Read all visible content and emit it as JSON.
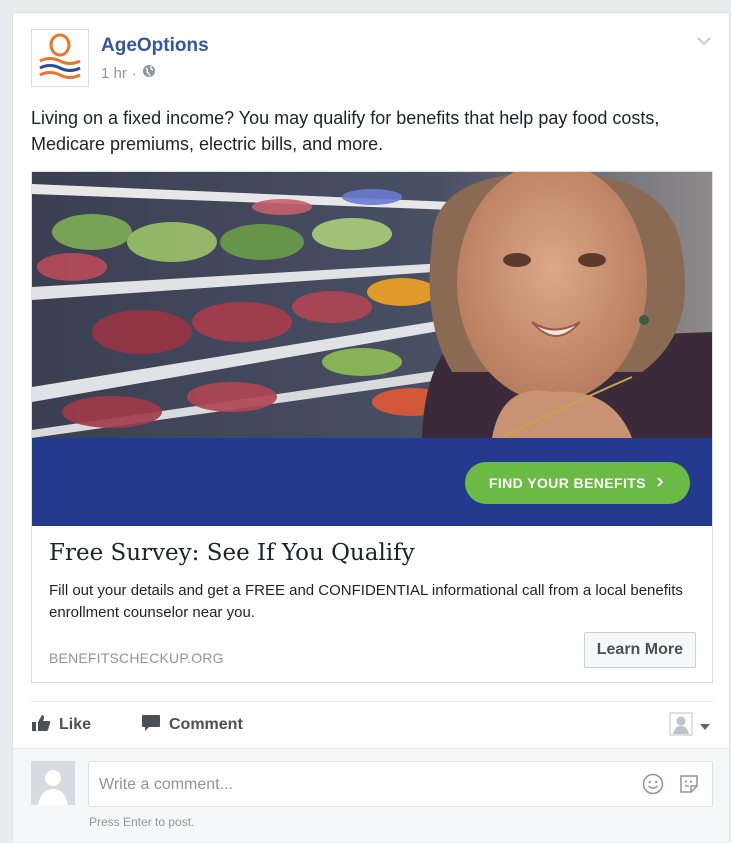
{
  "post": {
    "page_name": "AgeOptions",
    "time": "1 hr",
    "separator": "·",
    "text": "Living on a fixed income? You may qualify for benefits that help pay food costs, Medicare premiums, electric bills, and more."
  },
  "ad": {
    "cta_banner_label": "FIND YOUR BENEFITS",
    "title": "Free Survey: See If You Qualify",
    "description": "Fill out your details and get a FREE and CONFIDENTIAL informational call from a local benefits enrollment counselor near you.",
    "domain": "BENEFITSCHECKUP.ORG",
    "learn_more_label": "Learn More"
  },
  "actions": {
    "like_label": "Like",
    "comment_label": "Comment"
  },
  "comment_box": {
    "placeholder": "Write a comment...",
    "hint": "Press Enter to post."
  },
  "colors": {
    "link_blue": "#365899",
    "band_blue": "#233a8f",
    "cta_green": "#6bba45",
    "logo_orange": "#e8762c",
    "logo_blue": "#2b4c9b"
  },
  "icons": [
    "globe-icon",
    "chevron-down-icon",
    "like-icon",
    "comment-icon",
    "audience-icon",
    "smiley-icon",
    "sticker-icon"
  ]
}
